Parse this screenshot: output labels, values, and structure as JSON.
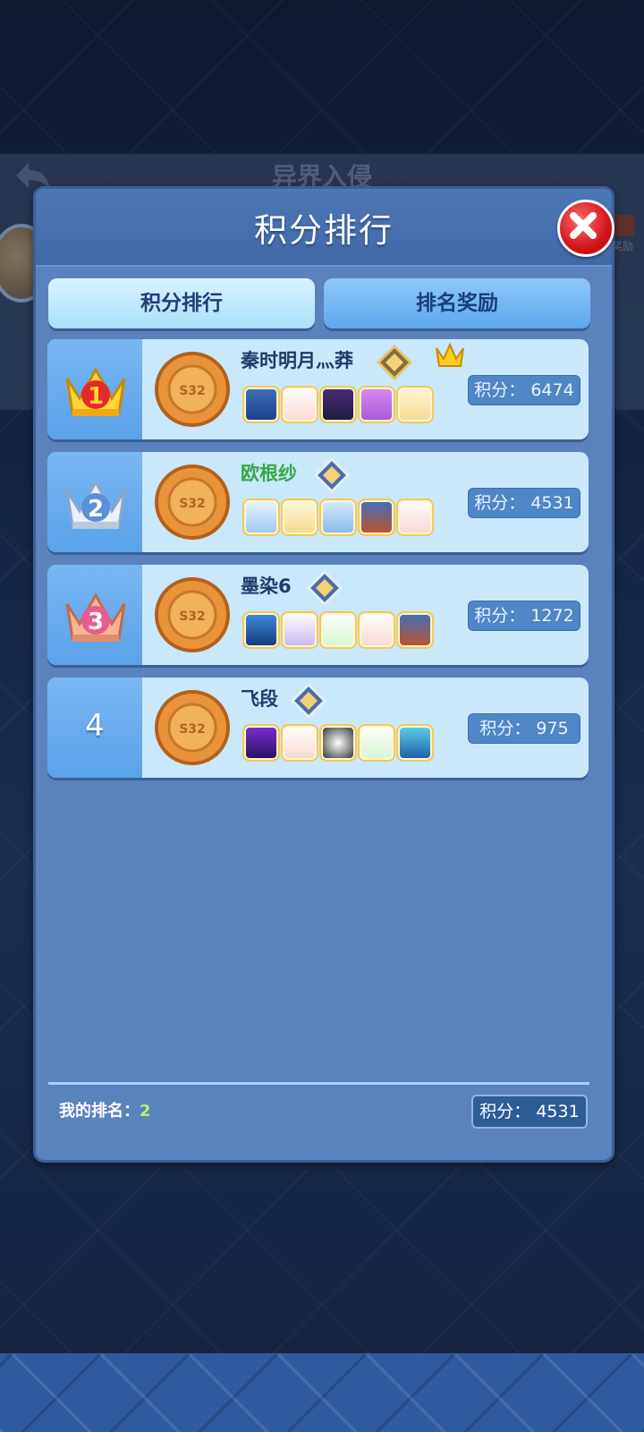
{
  "background_screen": {
    "title": "异界入侵",
    "reward_label": "奖励"
  },
  "dialog": {
    "title": "积分排行",
    "tabs": [
      {
        "label": "积分排行",
        "active": true
      },
      {
        "label": "排名奖励",
        "active": false
      }
    ],
    "score_prefix": "积分：",
    "medal_label": "S32",
    "rows": [
      {
        "rank": "1",
        "crown": "gold-crown-icon",
        "name": "秦时明月灬莽",
        "score": "6474",
        "score_label": "积分：  6474",
        "skills": [
          "robot-skill-icon",
          "hat-skill-icon",
          "archer-skill-icon",
          "lock-skill-icon",
          "cross-skill-icon"
        ]
      },
      {
        "rank": "2",
        "crown": "silver-crown-icon",
        "name": "欧根纱",
        "score": "4531",
        "score_label": "积分：  4531",
        "skills": [
          "robot-face-skill-icon",
          "cross-skill-icon",
          "ice-skill-icon",
          "figure-skill-icon",
          "hat-skill-icon"
        ]
      },
      {
        "rank": "3",
        "crown": "bronze-crown-icon",
        "name": "墨染6",
        "score": "1272",
        "score_label": "积分：  1272",
        "skills": [
          "bird-skill-icon",
          "magic-hat-skill-icon",
          "heal-skill-icon",
          "hat-skill-icon",
          "figure-skill-icon"
        ]
      },
      {
        "rank": "4",
        "crown": "",
        "name": "飞段",
        "score": "975",
        "score_label": "积分：   975",
        "skills": [
          "slash-skill-icon",
          "hat-skill-icon",
          "yin-yang-skill-icon",
          "heal-skill-icon",
          "wave-skill-icon"
        ]
      }
    ],
    "footer": {
      "my_rank_label": "我的排名：",
      "my_rank_value": "2",
      "my_score_label": "积分：  4531"
    }
  },
  "colors": {
    "dialog_bg": "#5a82bd",
    "row_bg": "#c9e8fb",
    "rank_cell": "#5aa2ea",
    "close": "#d3141b",
    "name_green": "#35a845"
  }
}
